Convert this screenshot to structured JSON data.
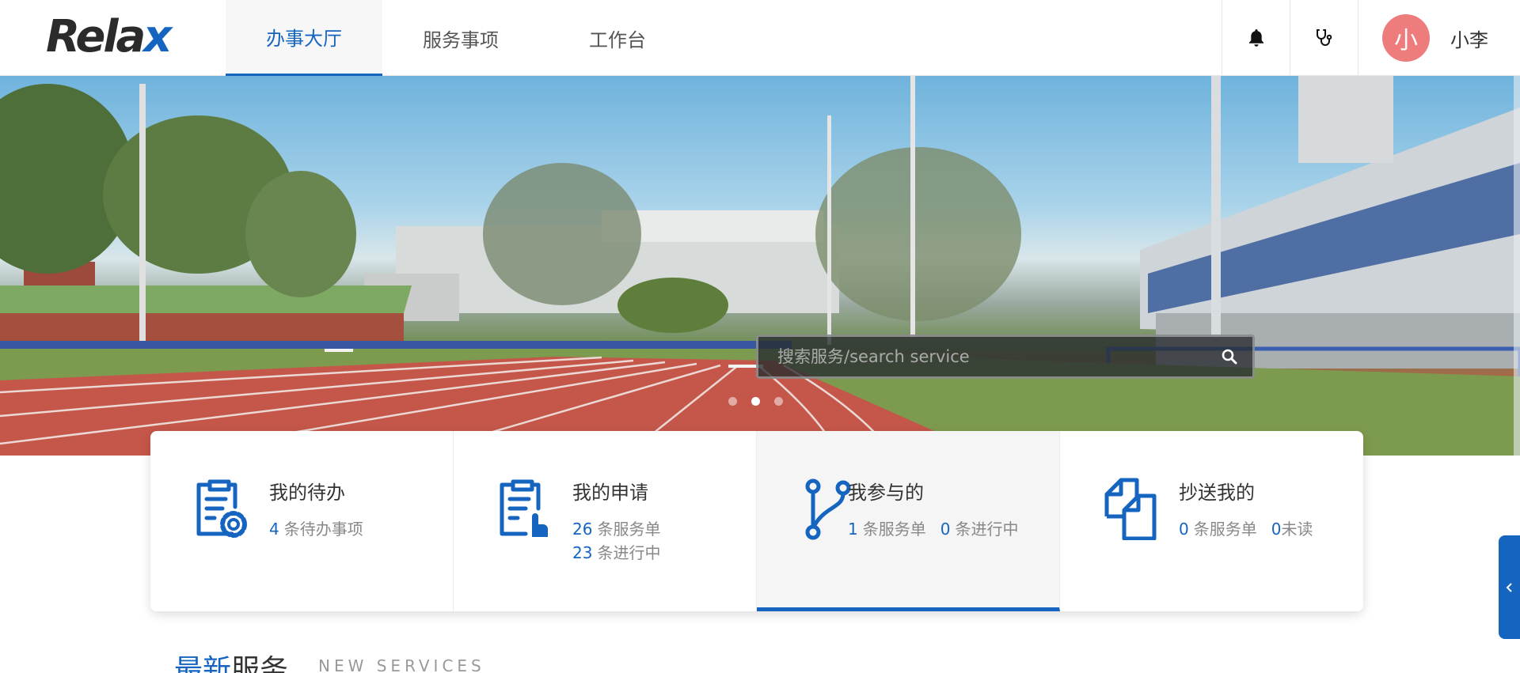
{
  "header": {
    "logo_text": "Rela",
    "logo_accent": "x",
    "nav": [
      {
        "label": "办事大厅",
        "active": true
      },
      {
        "label": "服务事项",
        "active": false
      },
      {
        "label": "工作台",
        "active": false
      }
    ],
    "icons": [
      "bell-icon",
      "stethoscope-icon"
    ],
    "user": {
      "avatar_text": "小",
      "name": "小李"
    }
  },
  "banner": {
    "search_placeholder": "搜索服务/search service",
    "carousel": {
      "count": 3,
      "active_index": 1
    }
  },
  "cards": [
    {
      "title": "我的待办",
      "icon": "clipboard-gear-icon",
      "lines": [
        [
          {
            "num": "4",
            "text": "条待办事项"
          }
        ]
      ]
    },
    {
      "title": "我的申请",
      "icon": "clipboard-hand-icon",
      "lines": [
        [
          {
            "num": "26",
            "text": "条服务单"
          }
        ],
        [
          {
            "num": "23",
            "text": "条进行中"
          }
        ]
      ]
    },
    {
      "title": "我参与的",
      "icon": "branch-icon",
      "active": true,
      "lines": [
        [
          {
            "num": "1",
            "text": "条服务单"
          },
          {
            "num": "0",
            "text": "条进行中"
          }
        ]
      ]
    },
    {
      "title": "抄送我的",
      "icon": "copy-docs-icon",
      "lines": [
        [
          {
            "num": "0",
            "text": "条服务单"
          },
          {
            "num": "0",
            "text": "未读"
          }
        ]
      ]
    }
  ],
  "section": {
    "title_hl": "最新",
    "title_rest": "服务",
    "subtitle": "NEW SERVICES"
  },
  "colors": {
    "accent": "#1565c0",
    "avatar": "#ef7c7c"
  }
}
